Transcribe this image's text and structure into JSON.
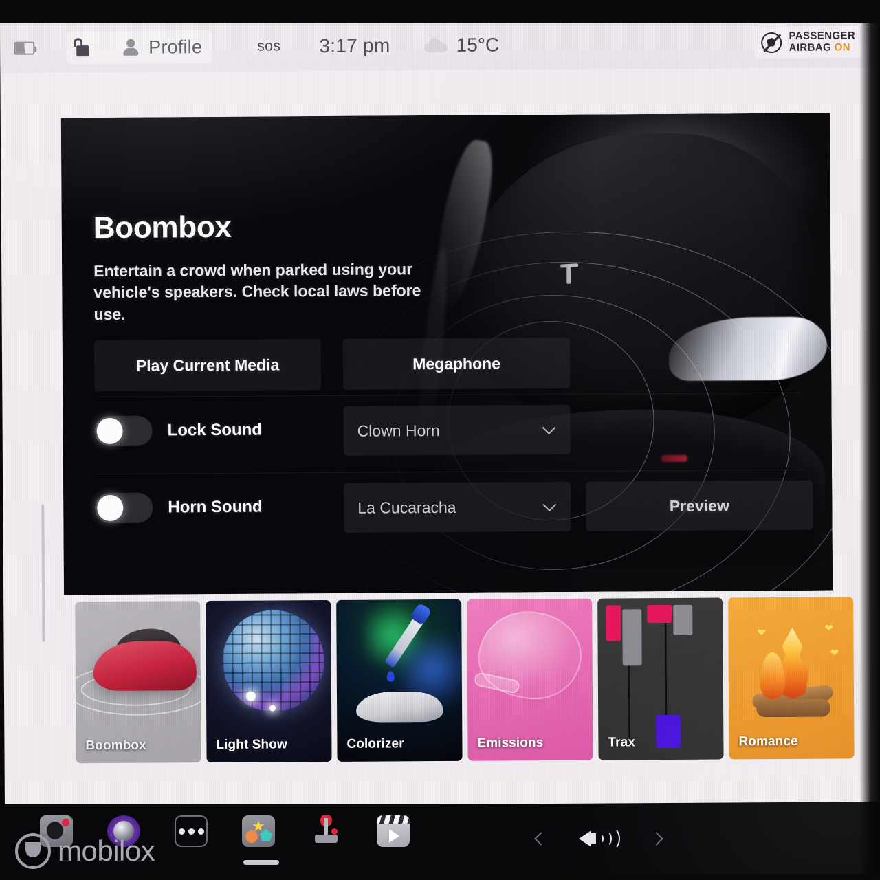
{
  "status_bar": {
    "battery_icon": "battery-icon",
    "lock_icon": "unlocked-padlock-icon",
    "profile_icon": "person-icon",
    "profile_label": "Profile",
    "sos_label": "sos",
    "time": "3:17 pm",
    "weather_icon": "cloud-icon",
    "temperature": "15°C",
    "airbag": {
      "icon": "passenger-airbag-icon",
      "line1": "PASSENGER",
      "line2": "AIRBAG",
      "state": "ON",
      "state_color": "#e09a2b"
    }
  },
  "hero": {
    "title": "Boombox",
    "description": "Entertain a crowd when parked using your vehicle's speakers. Check local laws before use.",
    "buttons": {
      "play_current_media": "Play Current Media",
      "megaphone": "Megaphone",
      "preview": "Preview"
    },
    "rows": [
      {
        "toggle_label": "Lock Sound",
        "toggle_state": "off",
        "select_value": "Clown Horn"
      },
      {
        "toggle_label": "Horn Sound",
        "toggle_state": "off",
        "select_value": "La Cucaracha"
      }
    ]
  },
  "cards": [
    {
      "label": "Boombox",
      "selected": true,
      "icon": "red-car-sound-rings-icon"
    },
    {
      "label": "Light Show",
      "selected": false,
      "icon": "disco-ball-icon"
    },
    {
      "label": "Colorizer",
      "selected": false,
      "icon": "eyedropper-car-icon"
    },
    {
      "label": "Emissions",
      "selected": false,
      "icon": "whoopee-cushion-icon"
    },
    {
      "label": "Trax",
      "selected": false,
      "icon": "mixer-faders-icon"
    },
    {
      "label": "Romance",
      "selected": false,
      "icon": "campfire-hearts-icon"
    }
  ],
  "taskbar": {
    "items": [
      {
        "name": "dashcam-icon"
      },
      {
        "name": "camera-icon"
      },
      {
        "name": "more-dots-icon"
      },
      {
        "name": "toybox-icon",
        "active": true
      },
      {
        "name": "arcade-joystick-icon"
      },
      {
        "name": "theater-icon"
      }
    ],
    "volume": {
      "prev_icon": "chevron-left-icon",
      "speaker_icon": "speaker-volume-icon",
      "next_icon": "chevron-right-icon"
    }
  },
  "watermark": {
    "text": "mobilox"
  }
}
